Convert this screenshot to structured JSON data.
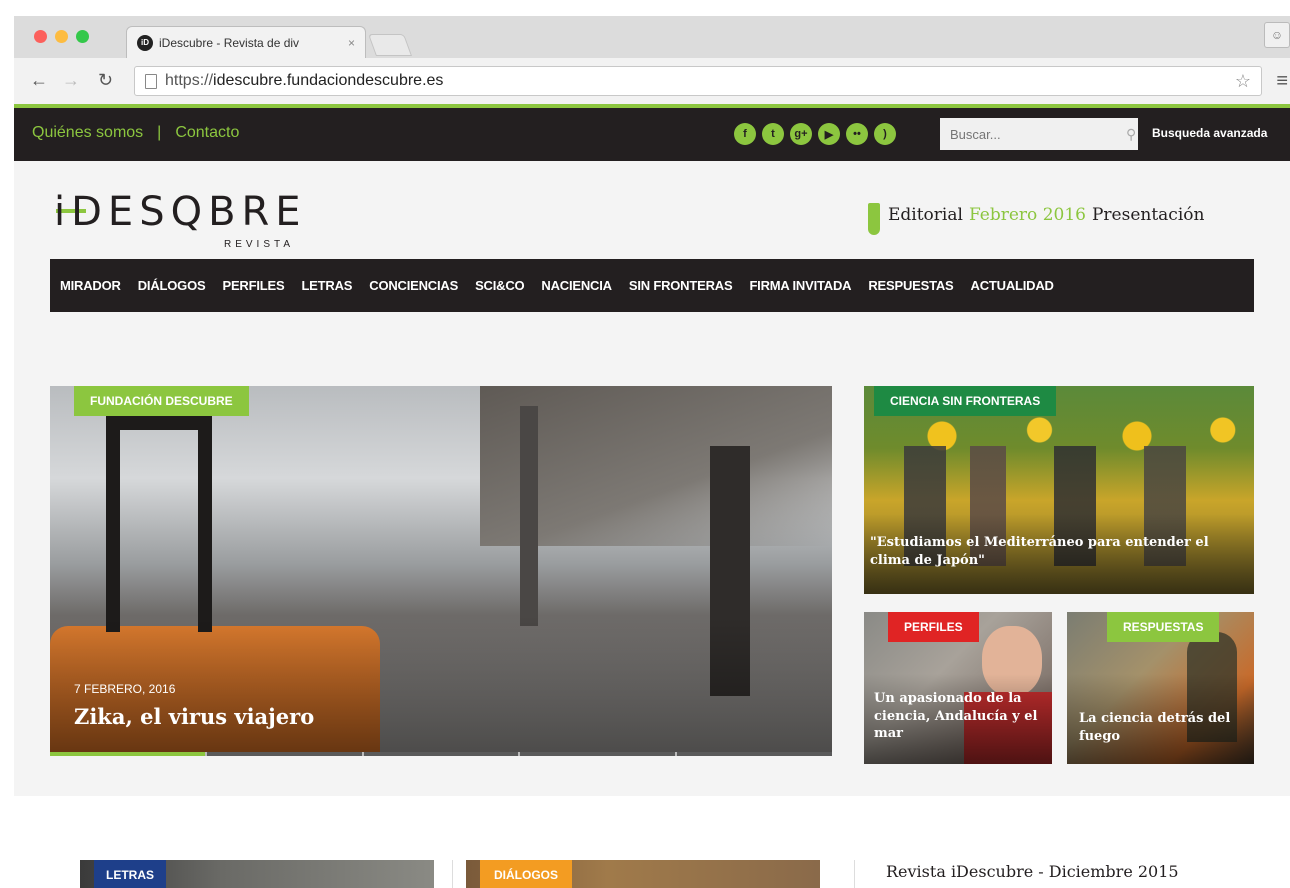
{
  "browser": {
    "tab_title": "iDescubre - Revista de div",
    "tab_close": "×",
    "favicon": "iD",
    "url_scheme": "https://",
    "url_host": "idescubre.fundaciondescubre.es",
    "colors": {
      "close": "#fc605c",
      "minimize": "#fdbc40",
      "maximize": "#34c84a"
    }
  },
  "topbar": {
    "links": [
      "Quiénes somos",
      "Contacto"
    ],
    "separator": "|",
    "socials": [
      {
        "icon": "facebook-icon",
        "glyph": "f"
      },
      {
        "icon": "twitter-icon",
        "glyph": "t"
      },
      {
        "icon": "google-plus-icon",
        "glyph": "g+"
      },
      {
        "icon": "youtube-icon",
        "glyph": "▶"
      },
      {
        "icon": "flickr-icon",
        "glyph": "••"
      },
      {
        "icon": "rss-icon",
        "glyph": ")"
      }
    ],
    "search_placeholder": "Buscar...",
    "advanced_search": "Busqueda avanzada"
  },
  "header": {
    "logo": "iDESQBRE",
    "logo_sub": "REVISTA",
    "editorial_label": "Editorial",
    "editorial_month": "Febrero 2016",
    "presentation": "Presentación"
  },
  "nav": [
    "MIRADOR",
    "DIÁLOGOS",
    "PERFILES",
    "LETRAS",
    "CONCIENCIAS",
    "SCI&CO",
    "NACIENCIA",
    "SIN FRONTERAS",
    "FIRMA INVITADA",
    "RESPUESTAS",
    "ACTUALIDAD"
  ],
  "hero": {
    "category": "FUNDACIÓN DESCUBRE",
    "date": "7 FEBRERO, 2016",
    "title": "Zika, el virus viajero",
    "category_color": "#8cc63f"
  },
  "side_cards": [
    {
      "category": "CIENCIA SIN FRONTERAS",
      "title": "\"Estudiamos el Mediterráneo para entender el clima de Japón\"",
      "color": "#1e8a43"
    },
    {
      "category": "PERFILES",
      "title": "Un apasionado de la ciencia, Andalucía y el mar",
      "color": "#e02424"
    },
    {
      "category": "RESPUESTAS",
      "title": "La ciencia detrás del fuego",
      "color": "#8cc63f"
    }
  ],
  "bottom": {
    "thumbs": [
      {
        "category": "LETRAS",
        "color": "#1e3f8a"
      },
      {
        "category": "DIÁLOGOS",
        "color": "#f39c22"
      }
    ],
    "revista_title": "Revista iDescubre - Diciembre 2015"
  },
  "brand": {
    "green": "#8cc63f",
    "dark": "#231f20"
  }
}
